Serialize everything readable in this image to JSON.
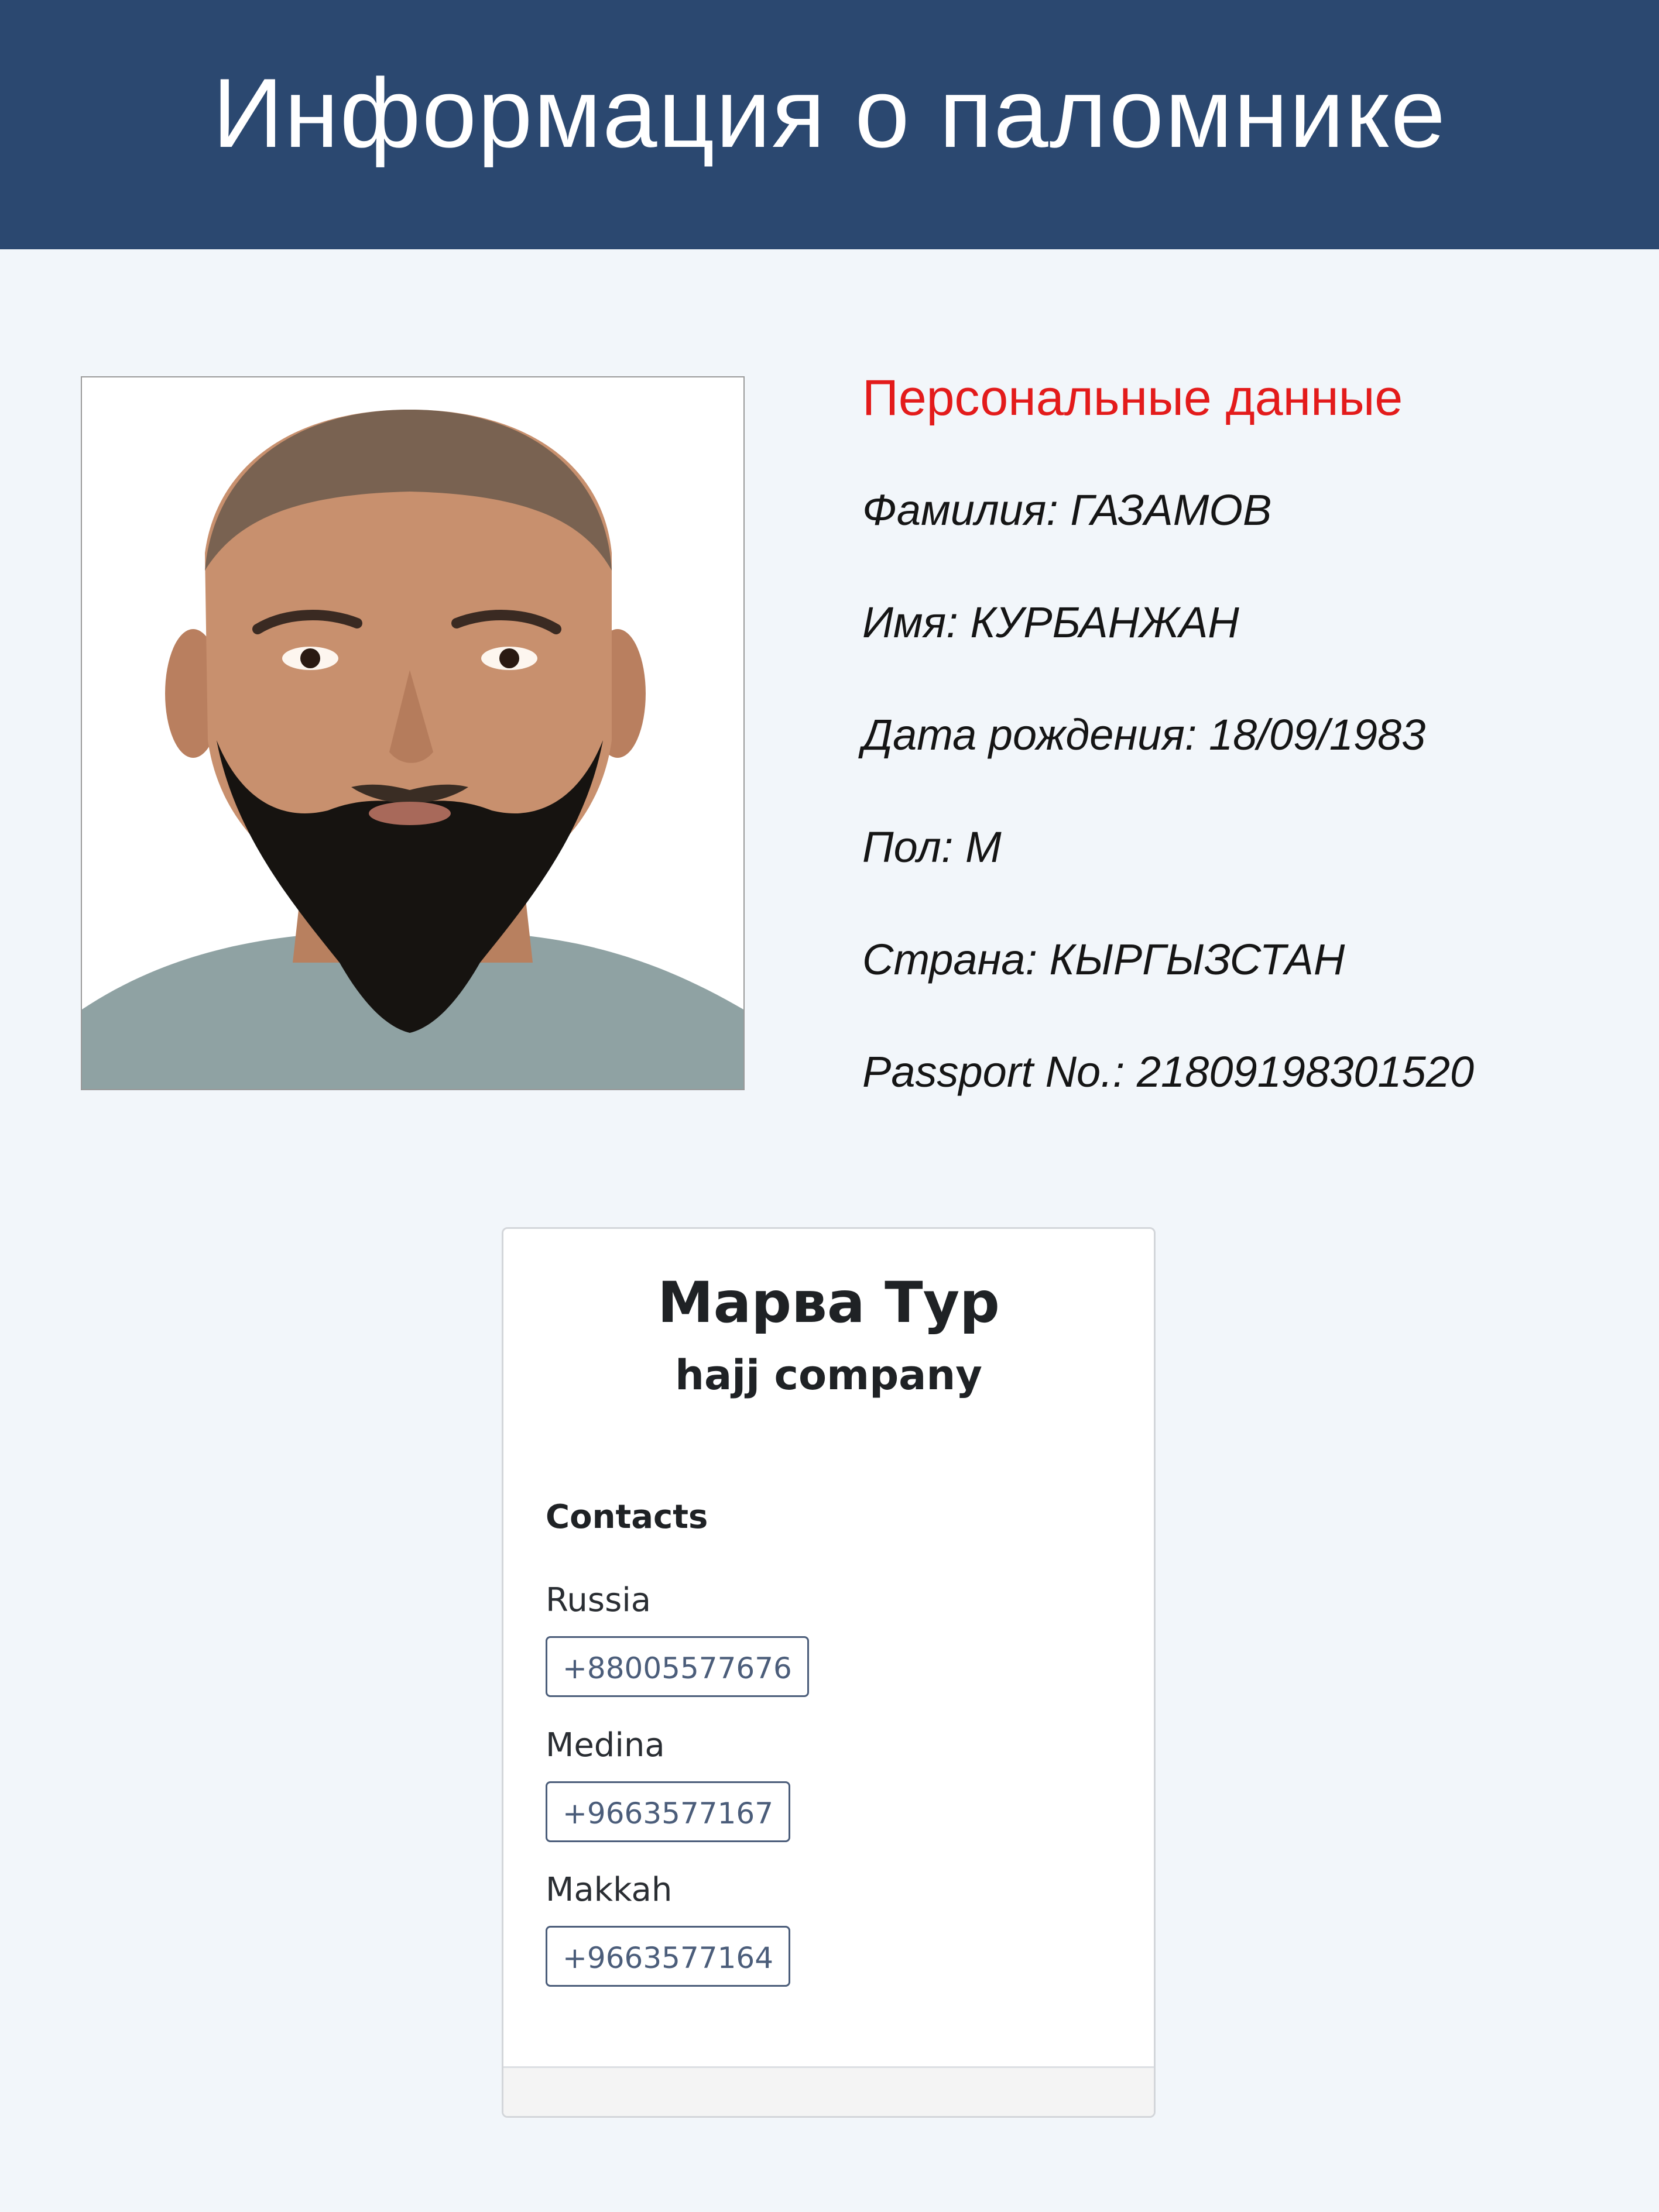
{
  "header": {
    "title": "Информация о паломнике"
  },
  "photo": {
    "icon": "person-photo",
    "colors": {
      "background": "#ffffff",
      "skin": "#c8906e",
      "beard": "#161310",
      "shirt": "#8fa2a3"
    }
  },
  "personal": {
    "title": "Персональные данные",
    "rows": [
      "Фамилия: ГАЗАМОВ",
      "Имя: КУРБАНЖАН",
      "Дата рождения: 18/09/1983",
      "Пол: М",
      "Страна: КЫРГЫЗСТАН",
      "Passport No.: 21809198301520"
    ]
  },
  "company": {
    "name": "Марва Тур",
    "subtitle": "hajj company",
    "contacts_heading": "Contacts",
    "contacts": [
      {
        "label": "Russia",
        "phone": "+88005577676"
      },
      {
        "label": "Medina",
        "phone": "+9663577167"
      },
      {
        "label": "Makkah",
        "phone": "+9663577164"
      }
    ]
  },
  "colors": {
    "header_bg": "#2b4870",
    "page_bg": "#f2f6fa",
    "accent_red": "#e31b1b",
    "phone_border": "#4b5d7a"
  }
}
